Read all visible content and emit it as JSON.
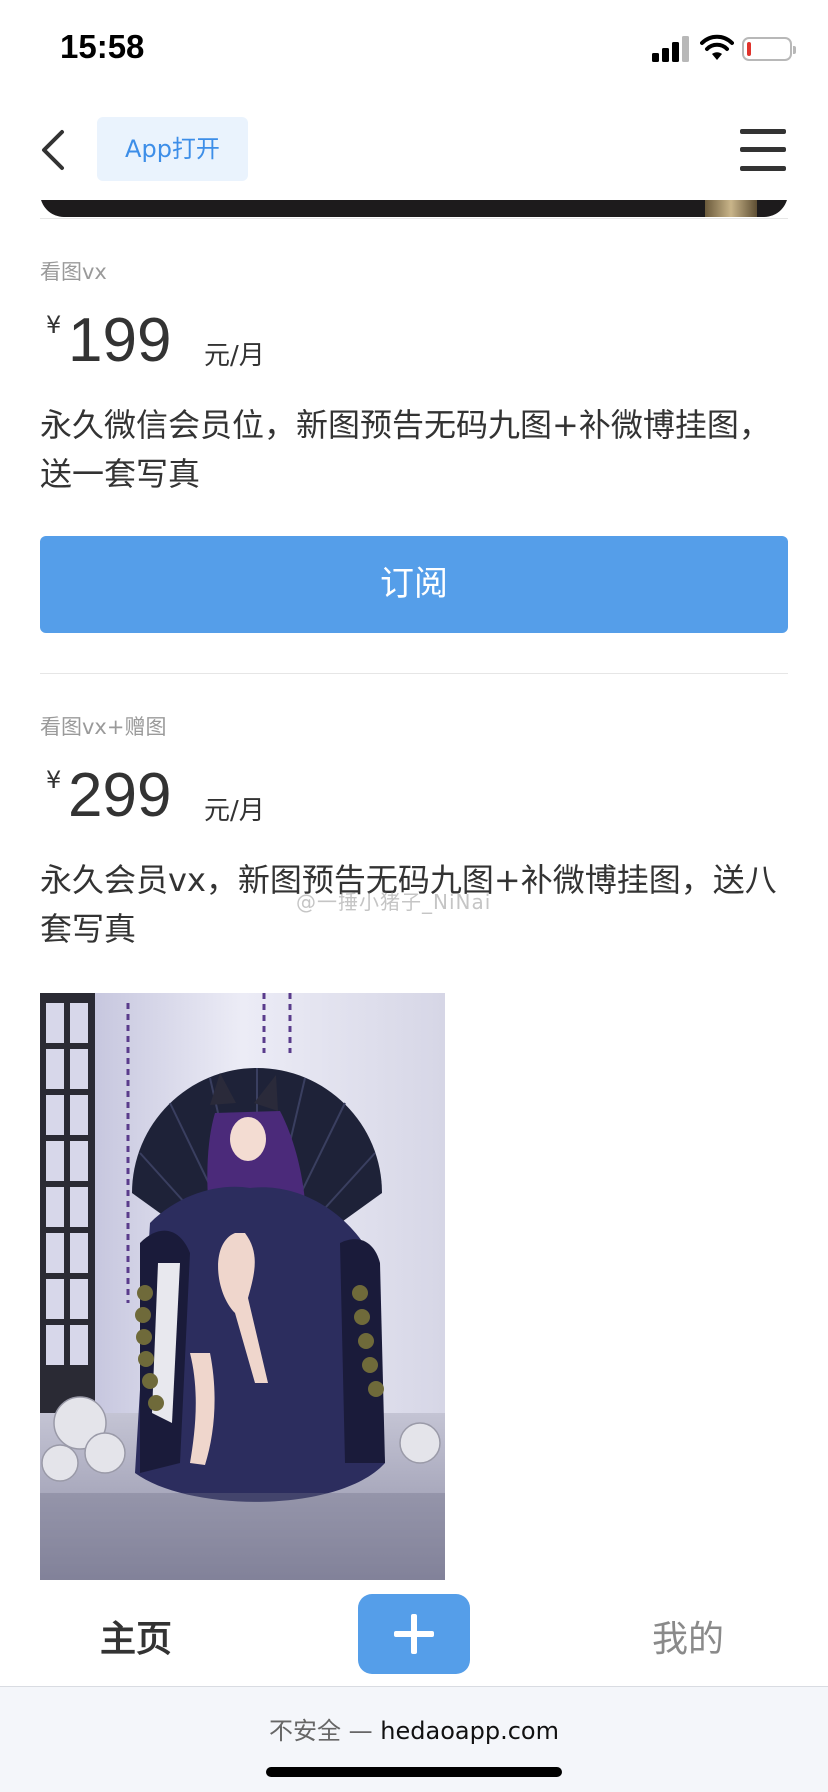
{
  "status_bar": {
    "time": "15:58"
  },
  "nav": {
    "app_open_label": "App打开"
  },
  "plans": [
    {
      "name": "看图vx",
      "currency": "¥",
      "amount": "199",
      "unit": "元/月",
      "description": "永久微信会员位，新图预告无码九图+补微博挂图，送一套写真",
      "subscribe_label": "订阅"
    },
    {
      "name": "看图vx+赠图",
      "currency": "¥",
      "amount": "299",
      "unit": "元/月",
      "description": "永久会员vx，新图预告无码九图+补微博挂图，送八套写真"
    }
  ],
  "watermark": "@一捶小猪子_NiNai",
  "tab_bar": {
    "home_label": "主页",
    "me_label": "我的"
  },
  "address_bar": {
    "insecure_label": "不安全 —",
    "domain": "hedaoapp.com"
  },
  "colors": {
    "accent": "#559ee9",
    "app_button_bg": "#eaf3fd",
    "app_button_text": "#3d8ee8"
  },
  "icons": [
    "back-chevron-icon",
    "menu-icon",
    "plus-icon",
    "signal-icon",
    "wifi-icon",
    "battery-icon"
  ]
}
